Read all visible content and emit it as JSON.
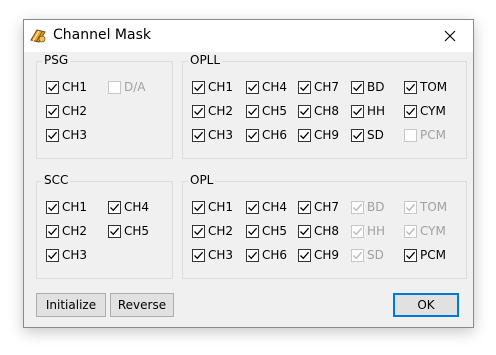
{
  "window": {
    "title": "Channel Mask"
  },
  "groups": {
    "psg": {
      "label": "PSG",
      "items": [
        {
          "label": "CH1",
          "checked": true,
          "enabled": true
        },
        {
          "label": "D/A",
          "checked": false,
          "enabled": false
        },
        {
          "label": "CH2",
          "checked": true,
          "enabled": true
        },
        {
          "label": "CH3",
          "checked": true,
          "enabled": true
        }
      ]
    },
    "opll": {
      "label": "OPLL",
      "items": [
        {
          "label": "CH1",
          "checked": true,
          "enabled": true
        },
        {
          "label": "CH4",
          "checked": true,
          "enabled": true
        },
        {
          "label": "CH7",
          "checked": true,
          "enabled": true
        },
        {
          "label": "BD",
          "checked": true,
          "enabled": true
        },
        {
          "label": "TOM",
          "checked": true,
          "enabled": true
        },
        {
          "label": "CH2",
          "checked": true,
          "enabled": true
        },
        {
          "label": "CH5",
          "checked": true,
          "enabled": true
        },
        {
          "label": "CH8",
          "checked": true,
          "enabled": true
        },
        {
          "label": "HH",
          "checked": true,
          "enabled": true
        },
        {
          "label": "CYM",
          "checked": true,
          "enabled": true
        },
        {
          "label": "CH3",
          "checked": true,
          "enabled": true
        },
        {
          "label": "CH6",
          "checked": true,
          "enabled": true
        },
        {
          "label": "CH9",
          "checked": true,
          "enabled": true
        },
        {
          "label": "SD",
          "checked": true,
          "enabled": true
        },
        {
          "label": "PCM",
          "checked": false,
          "enabled": false
        }
      ]
    },
    "scc": {
      "label": "SCC",
      "items": [
        {
          "label": "CH1",
          "checked": true,
          "enabled": true
        },
        {
          "label": "CH4",
          "checked": true,
          "enabled": true
        },
        {
          "label": "CH2",
          "checked": true,
          "enabled": true
        },
        {
          "label": "CH5",
          "checked": true,
          "enabled": true
        },
        {
          "label": "CH3",
          "checked": true,
          "enabled": true
        }
      ]
    },
    "opl": {
      "label": "OPL",
      "items": [
        {
          "label": "CH1",
          "checked": true,
          "enabled": true
        },
        {
          "label": "CH4",
          "checked": true,
          "enabled": true
        },
        {
          "label": "CH7",
          "checked": true,
          "enabled": true
        },
        {
          "label": "BD",
          "checked": true,
          "enabled": false
        },
        {
          "label": "TOM",
          "checked": true,
          "enabled": false
        },
        {
          "label": "CH2",
          "checked": true,
          "enabled": true
        },
        {
          "label": "CH5",
          "checked": true,
          "enabled": true
        },
        {
          "label": "CH8",
          "checked": true,
          "enabled": true
        },
        {
          "label": "HH",
          "checked": true,
          "enabled": false
        },
        {
          "label": "CYM",
          "checked": true,
          "enabled": false
        },
        {
          "label": "CH3",
          "checked": true,
          "enabled": true
        },
        {
          "label": "CH6",
          "checked": true,
          "enabled": true
        },
        {
          "label": "CH9",
          "checked": true,
          "enabled": true
        },
        {
          "label": "SD",
          "checked": true,
          "enabled": false
        },
        {
          "label": "PCM",
          "checked": true,
          "enabled": true
        }
      ]
    }
  },
  "buttons": {
    "initialize": "Initialize",
    "reverse": "Reverse",
    "ok": "OK"
  },
  "colors": {
    "accent": "#0078d7",
    "disabled_text": "#a0a0a0"
  }
}
